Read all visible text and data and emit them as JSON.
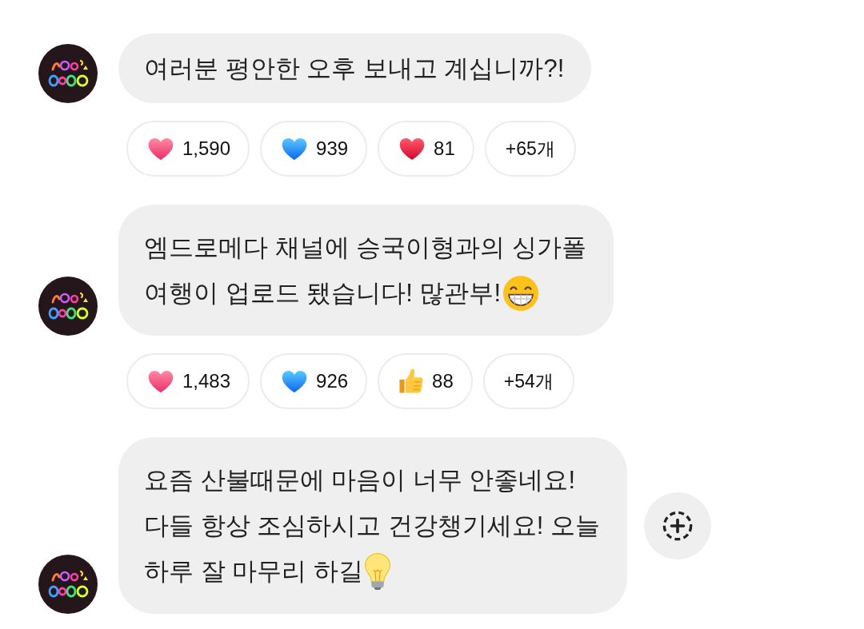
{
  "messages": [
    {
      "lines": [
        "여러분 평안한 오후 보내고 계십니까?!"
      ],
      "reactions": [
        {
          "kind": "pink-heart",
          "count": "1,590"
        },
        {
          "kind": "blue-heart",
          "count": "939"
        },
        {
          "kind": "red-heart",
          "count": "81"
        }
      ],
      "more_reactions": "+65개"
    },
    {
      "lines": [
        "엠드로메다 채널에 승국이형과의 싱가폴",
        "여행이 업로드 됐습니다! 많관부!"
      ],
      "trailing_emoji": {
        "kind": "grinning-face"
      },
      "reactions": [
        {
          "kind": "pink-heart",
          "count": "1,483"
        },
        {
          "kind": "blue-heart",
          "count": "926"
        },
        {
          "kind": "thumbs-up",
          "count": "88"
        }
      ],
      "more_reactions": "+54개"
    },
    {
      "lines": [
        "요즘 산불때문에 마음이 너무 안좋네요!",
        "다들 항상 조심하시고 건강챙기세요! 오늘",
        "하루 잘 마무리 하길"
      ],
      "trailing_emoji": {
        "kind": "light-bulb"
      },
      "add_reaction_button": true
    }
  ]
}
